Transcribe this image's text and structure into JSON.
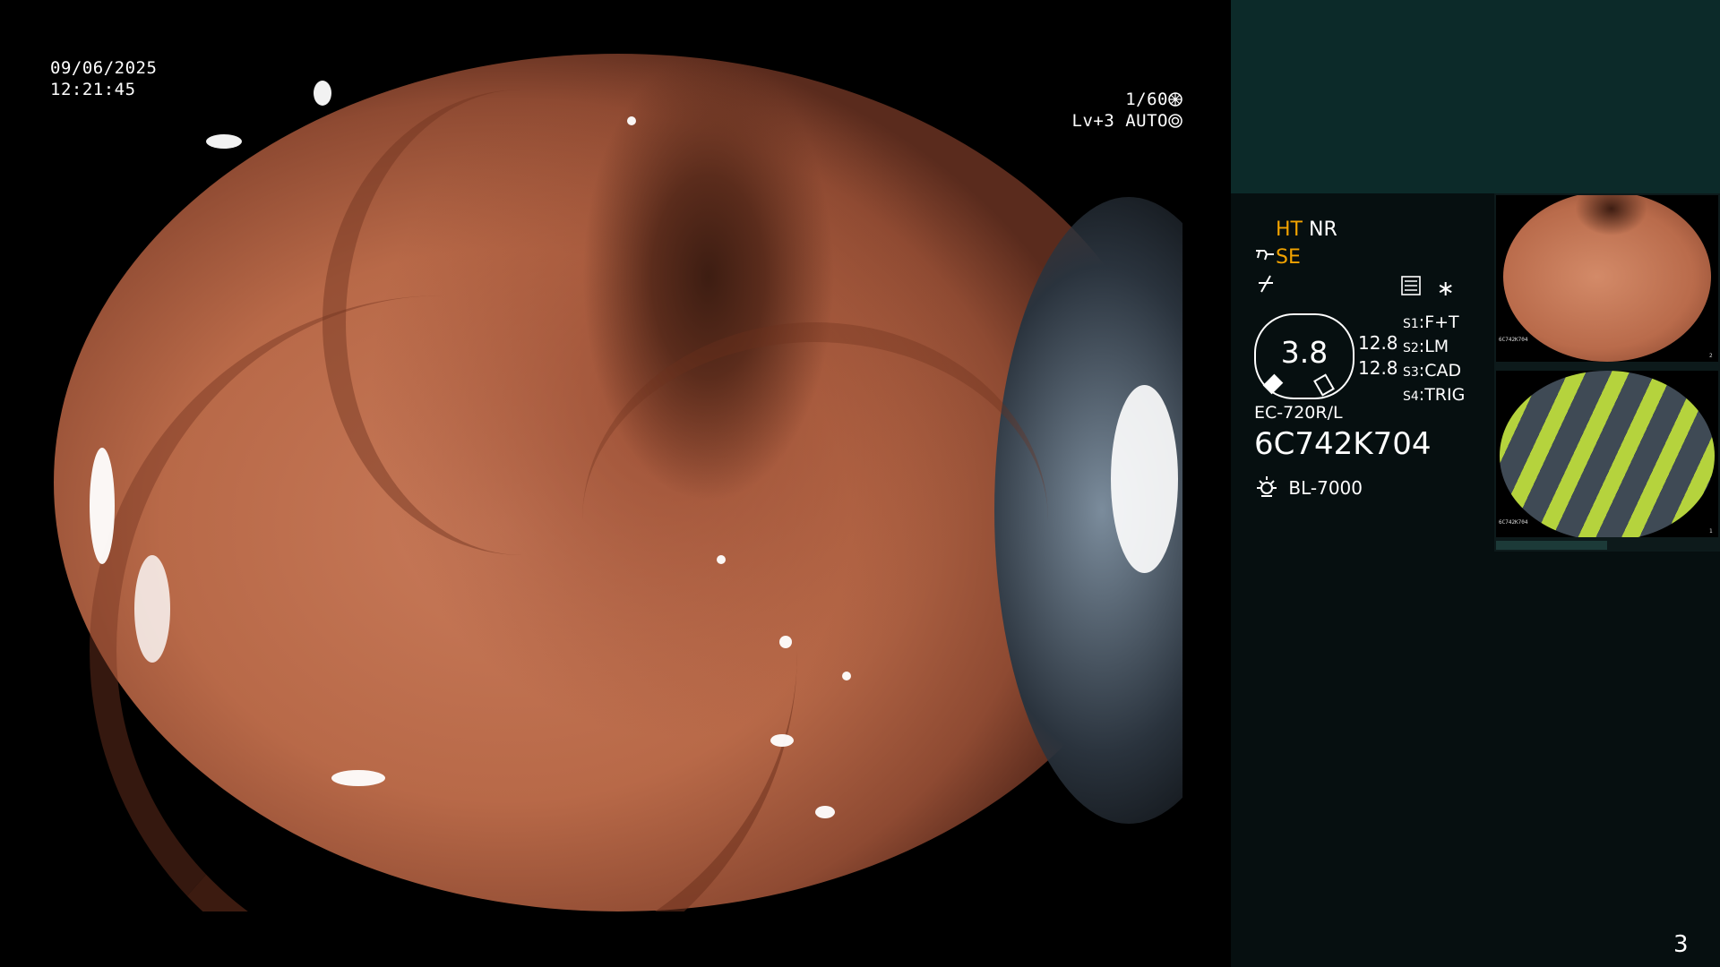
{
  "overlay": {
    "date": "09/06/2025",
    "time": "12:21:45",
    "shutter": "1/60",
    "shutter_icon": "shutter-icon",
    "level": "Lv+3",
    "mode": "AUTO",
    "mode_icon": "auto-iris-icon"
  },
  "panel": {
    "ht": "HT",
    "nr": "NR",
    "se": "SE",
    "se_icon": "scope-icon",
    "freeze_icon": "freeze-icon",
    "menu_icon": "memo-icon",
    "star": "∗",
    "scale_value": "3.8",
    "readout1": "12.8",
    "readout2": "12.8",
    "switches": [
      {
        "key": "S1",
        "value": "F+T"
      },
      {
        "key": "S2",
        "value": "LM"
      },
      {
        "key": "S3",
        "value": "CAD"
      },
      {
        "key": "S4",
        "value": "TRIG"
      }
    ],
    "scope_model": "EC-720R/L",
    "serial": "6C742K704",
    "light_icon": "light-source-icon",
    "light_source": "BL-7000",
    "page_number": "3"
  },
  "thumbnails": [
    {
      "name": "colon-thumbnail",
      "serial": "6C742K704",
      "index": "2"
    },
    {
      "name": "pattern-thumbnail",
      "serial": "6C742K704",
      "index": "1"
    }
  ],
  "colors": {
    "accent_orange": "#f2a300",
    "panel_bg": "#060f10",
    "panel_top_bg": "#0c2a29",
    "thumb_green": "#b5d33d",
    "thumb_gray": "#3f4a55"
  }
}
